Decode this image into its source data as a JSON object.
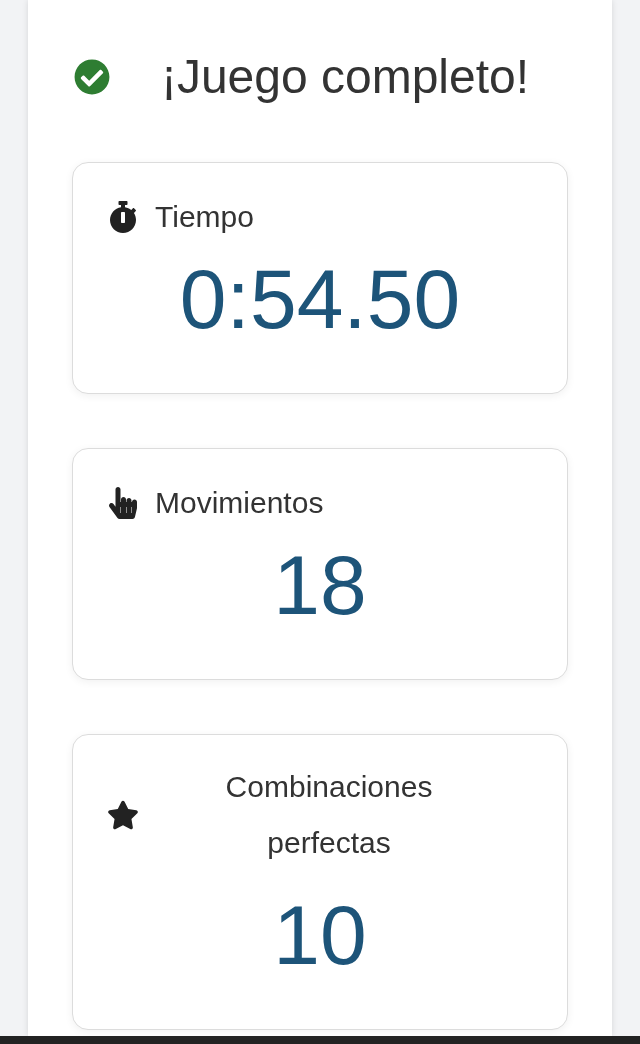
{
  "title": "¡Juego completo!",
  "stats": [
    {
      "kind": "time",
      "label": "Tiempo",
      "value": "0:54.50"
    },
    {
      "kind": "moves",
      "label": "Movimientos",
      "value": "18"
    },
    {
      "kind": "perfect",
      "label": "Combinaciones perfectas",
      "value": "10"
    }
  ]
}
